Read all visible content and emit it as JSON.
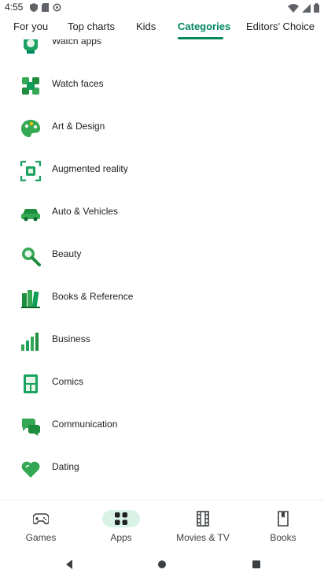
{
  "status_bar": {
    "time": "4:55"
  },
  "tabs": [
    {
      "label": "For you"
    },
    {
      "label": "Top charts"
    },
    {
      "label": "Kids"
    },
    {
      "label": "Categories"
    },
    {
      "label": "Editors' Choice"
    }
  ],
  "active_tab": "Categories",
  "categories": [
    {
      "label": "Watch apps",
      "icon": "watch-apps-icon"
    },
    {
      "label": "Watch faces",
      "icon": "watch-faces-icon"
    },
    {
      "label": "Art & Design",
      "icon": "art-design-icon"
    },
    {
      "label": "Augmented reality",
      "icon": "augmented-reality-icon"
    },
    {
      "label": "Auto & Vehicles",
      "icon": "auto-vehicles-icon"
    },
    {
      "label": "Beauty",
      "icon": "beauty-icon"
    },
    {
      "label": "Books & Reference",
      "icon": "books-reference-icon"
    },
    {
      "label": "Business",
      "icon": "business-icon"
    },
    {
      "label": "Comics",
      "icon": "comics-icon"
    },
    {
      "label": "Communication",
      "icon": "communication-icon"
    },
    {
      "label": "Dating",
      "icon": "dating-icon"
    }
  ],
  "bottom_nav": [
    {
      "label": "Games",
      "icon": "gamepad-icon"
    },
    {
      "label": "Apps",
      "icon": "apps-grid-icon"
    },
    {
      "label": "Movies & TV",
      "icon": "film-icon"
    },
    {
      "label": "Books",
      "icon": "book-icon"
    }
  ],
  "active_nav": "Apps",
  "colors": {
    "accent": "#01875f",
    "nav_active_bg": "#d9f2e6"
  }
}
